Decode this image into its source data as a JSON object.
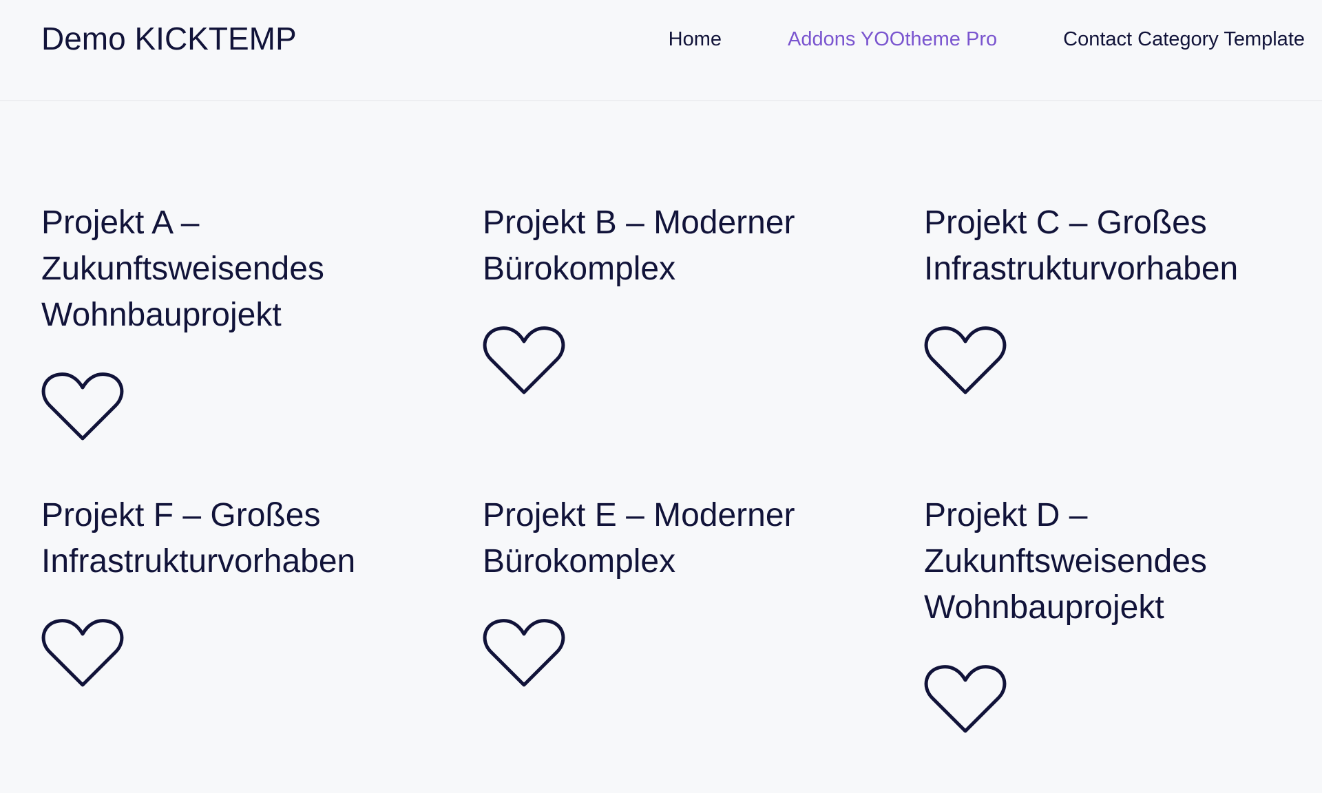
{
  "site": {
    "logo": "Demo KICKTEMP"
  },
  "nav": {
    "items": [
      {
        "label": "Home",
        "active": false
      },
      {
        "label": "Addons YOOtheme Pro",
        "active": true
      },
      {
        "label": "Contact Category Template",
        "active": false
      }
    ]
  },
  "colors": {
    "text": "#111339",
    "accent": "#7a55cf",
    "background": "#f7f8fa"
  },
  "projects": [
    {
      "title": "Projekt A – Zukunftsweisendes Wohnbauprojekt",
      "icon": "heart-outline-icon"
    },
    {
      "title": "Projekt B – Moderner Bürokomplex",
      "icon": "heart-outline-icon"
    },
    {
      "title": "Projekt C – Großes Infrastrukturvorhaben",
      "icon": "heart-outline-icon"
    },
    {
      "title": "Projekt F – Großes Infrastrukturvorhaben",
      "icon": "heart-outline-icon"
    },
    {
      "title": "Projekt E – Moderner Bürokomplex",
      "icon": "heart-outline-icon"
    },
    {
      "title": "Projekt D – Zukunftsweisendes Wohnbauprojekt",
      "icon": "heart-outline-icon"
    }
  ]
}
